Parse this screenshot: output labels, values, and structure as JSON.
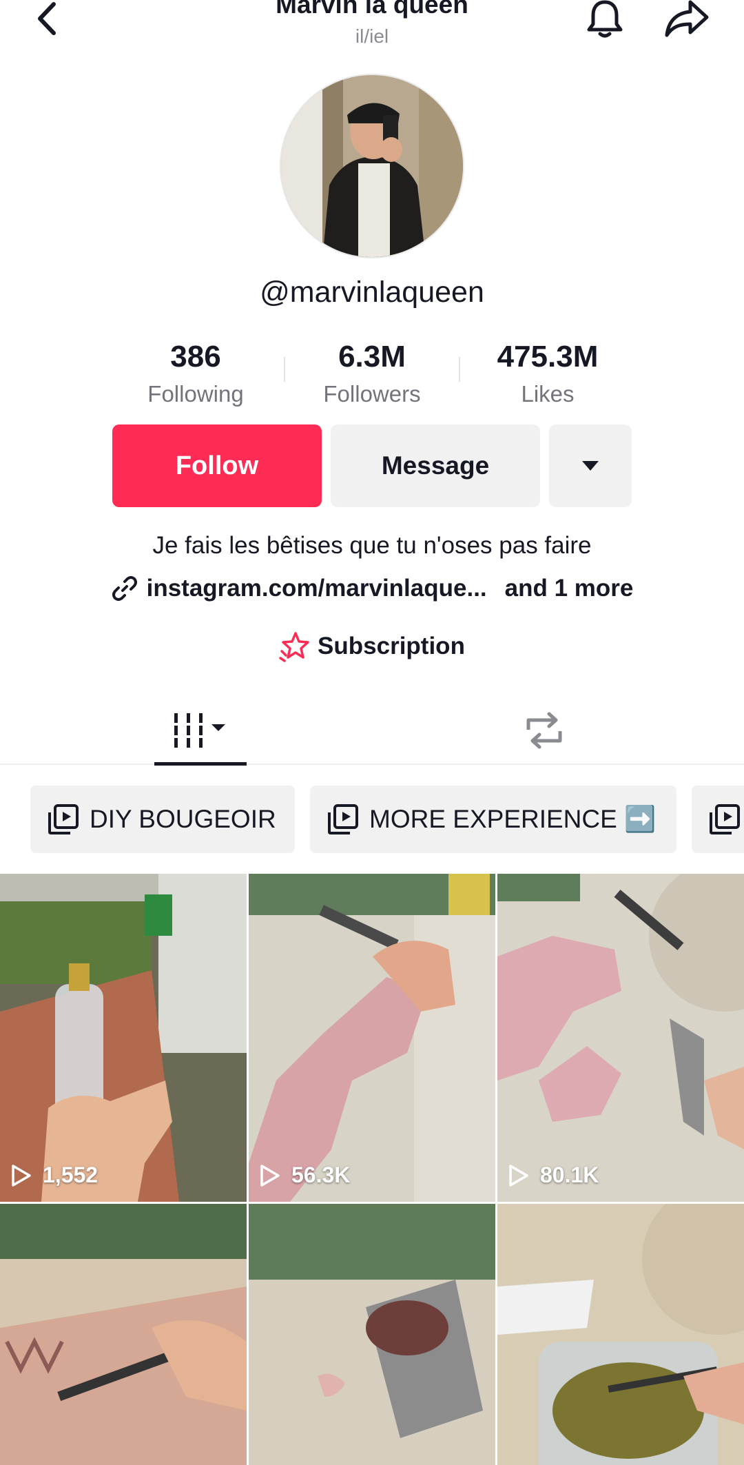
{
  "header": {
    "title": "Marvin la queen",
    "pronouns": "il/iel",
    "icons": {
      "back": "chevron-left-icon",
      "bell": "bell-icon",
      "share": "share-arrow-icon"
    }
  },
  "profile": {
    "handle": "@marvinlaqueen",
    "stats": [
      {
        "value": "386",
        "label": "Following"
      },
      {
        "value": "6.3M",
        "label": "Followers"
      },
      {
        "value": "475.3M",
        "label": "Likes"
      }
    ],
    "bio": "Je fais les bêtises que tu n'oses pas faire",
    "link": "instagram.com/marvinlaque...",
    "link_more": "and 1 more",
    "subscription": "Subscription"
  },
  "actions": {
    "follow": "Follow",
    "message": "Message"
  },
  "playlists": [
    {
      "label": "DIY BOUGEOIR"
    },
    {
      "label": "MORE EXPERIENCE ➡️"
    },
    {
      "label": ""
    }
  ],
  "videos": [
    {
      "views": "1,552"
    },
    {
      "views": "56.3K"
    },
    {
      "views": "80.1K"
    },
    {
      "views": ""
    },
    {
      "views": ""
    },
    {
      "views": ""
    }
  ],
  "colors": {
    "accent": "#fe2c55",
    "button_grey": "#f1f1f2",
    "text": "#161823",
    "muted": "#73747b"
  }
}
